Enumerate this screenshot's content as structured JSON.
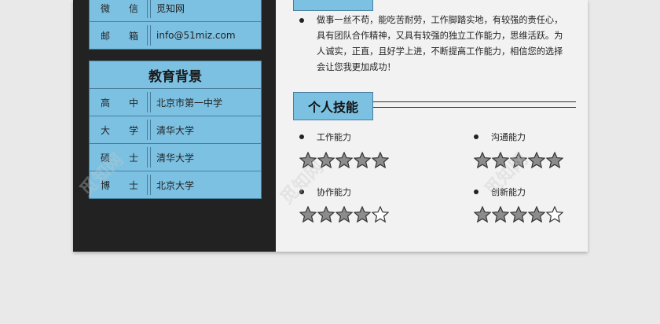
{
  "contact": [
    {
      "k1": "微",
      "k2": "信",
      "value": "觅知网"
    },
    {
      "k1": "邮",
      "k2": "箱",
      "value": "info@51miz.com"
    }
  ],
  "education": {
    "title": "教育背景",
    "rows": [
      {
        "k1": "高",
        "k2": "中",
        "value": "北京市第一中学"
      },
      {
        "k1": "大",
        "k2": "学",
        "value": "清华大学"
      },
      {
        "k1": "硕",
        "k2": "士",
        "value": "清华大学"
      },
      {
        "k1": "博",
        "k2": "士",
        "value": "北京大学"
      }
    ]
  },
  "evaluation": {
    "lines": [
      "做事一丝不苟，能吃苦耐劳，工作脚踏实地，有较强的责任心，",
      "具有团队合作精神，又具有较强的独立工作能力，思维活跃。为",
      "人诚实，正直，且好学上进，不断提高工作能力，相信您的选择",
      "会让您我更加成功！"
    ]
  },
  "skills": {
    "title": "个人技能",
    "items": [
      {
        "label": "工作能力",
        "rating": 5
      },
      {
        "label": "沟通能力",
        "rating": 5
      },
      {
        "label": "协作能力",
        "rating": 4
      },
      {
        "label": "创新能力",
        "rating": 4
      }
    ]
  },
  "watermark": "觅知网",
  "colors": {
    "accent": "#7cc1e2",
    "dark": "#222222",
    "star_fill": "#8c8c8c"
  }
}
